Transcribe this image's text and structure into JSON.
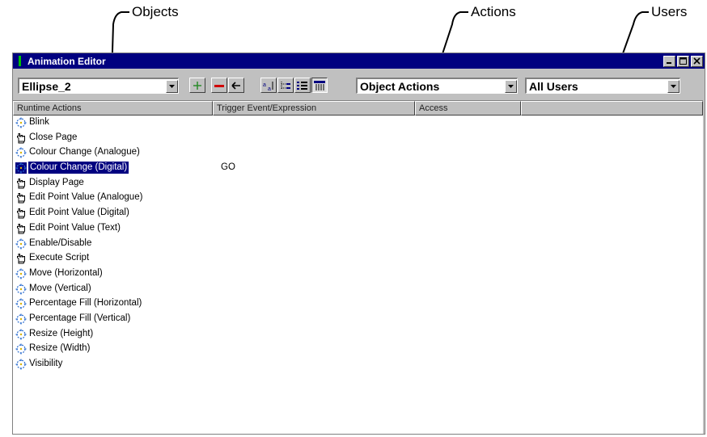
{
  "callouts": {
    "objects": "Objects",
    "actions": "Actions",
    "users": "Users"
  },
  "window": {
    "title": "Animation Editor",
    "object_select": "Ellipse_2",
    "actions_select": "Object Actions",
    "users_select": "All Users"
  },
  "toolbar": {
    "buttons": [
      "add-icon",
      "remove-icon",
      "back-arrow-icon",
      "sort-icon",
      "tree-view-icon",
      "list-view-icon",
      "details-view-icon"
    ],
    "pressed": "details-view-icon"
  },
  "columns": [
    "Runtime Actions",
    "Trigger Event/Expression",
    "Access",
    ""
  ],
  "rows": [
    {
      "icon": "animation-icon",
      "label": "Blink",
      "trigger": ""
    },
    {
      "icon": "hand-icon",
      "label": "Close Page",
      "trigger": ""
    },
    {
      "icon": "animation-icon",
      "label": "Colour Change (Analogue)",
      "trigger": ""
    },
    {
      "icon": "animation-icon",
      "label": "Colour Change (Digital)",
      "trigger": "GO",
      "selected": true
    },
    {
      "icon": "hand-icon",
      "label": "Display Page",
      "trigger": ""
    },
    {
      "icon": "hand-icon",
      "label": "Edit Point Value (Analogue)",
      "trigger": ""
    },
    {
      "icon": "hand-icon",
      "label": "Edit Point Value (Digital)",
      "trigger": ""
    },
    {
      "icon": "hand-icon",
      "label": "Edit Point Value (Text)",
      "trigger": ""
    },
    {
      "icon": "animation-icon",
      "label": "Enable/Disable",
      "trigger": ""
    },
    {
      "icon": "hand-icon",
      "label": "Execute Script",
      "trigger": ""
    },
    {
      "icon": "animation-icon",
      "label": "Move (Horizontal)",
      "trigger": ""
    },
    {
      "icon": "animation-icon",
      "label": "Move (Vertical)",
      "trigger": ""
    },
    {
      "icon": "animation-icon",
      "label": "Percentage Fill (Horizontal)",
      "trigger": ""
    },
    {
      "icon": "animation-icon",
      "label": "Percentage Fill (Vertical)",
      "trigger": ""
    },
    {
      "icon": "animation-icon",
      "label": "Resize (Height)",
      "trigger": ""
    },
    {
      "icon": "animation-icon",
      "label": "Resize (Width)",
      "trigger": ""
    },
    {
      "icon": "animation-icon",
      "label": "Visibility",
      "trigger": ""
    }
  ],
  "colors": {
    "titlebar": "#000080",
    "chrome": "#c0c0c0",
    "selection": "#000080",
    "add": "#2a8c2a",
    "remove": "#d00000"
  }
}
